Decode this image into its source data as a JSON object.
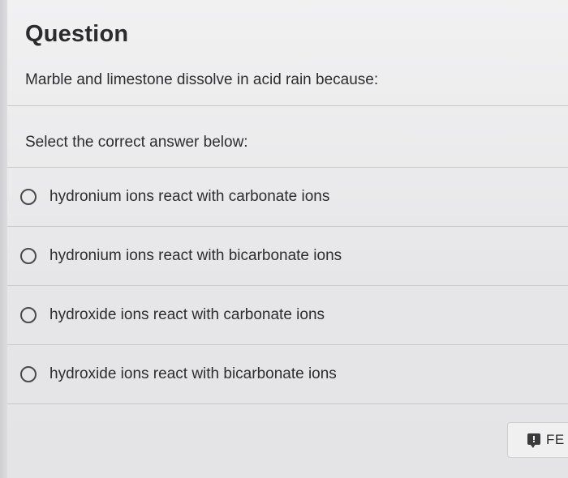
{
  "question": {
    "title": "Question",
    "prompt": "Marble and limestone dissolve in acid rain because:",
    "instruction": "Select the correct answer below:",
    "options": [
      {
        "label": "hydronium ions react with carbonate ions",
        "selected": false
      },
      {
        "label": "hydronium ions react with bicarbonate ions",
        "selected": false
      },
      {
        "label": "hydroxide ions react with carbonate ions",
        "selected": false
      },
      {
        "label": "hydroxide ions react with bicarbonate ions",
        "selected": false
      }
    ]
  },
  "feedback_button": {
    "label": "FE",
    "icon": "feedback-icon"
  }
}
